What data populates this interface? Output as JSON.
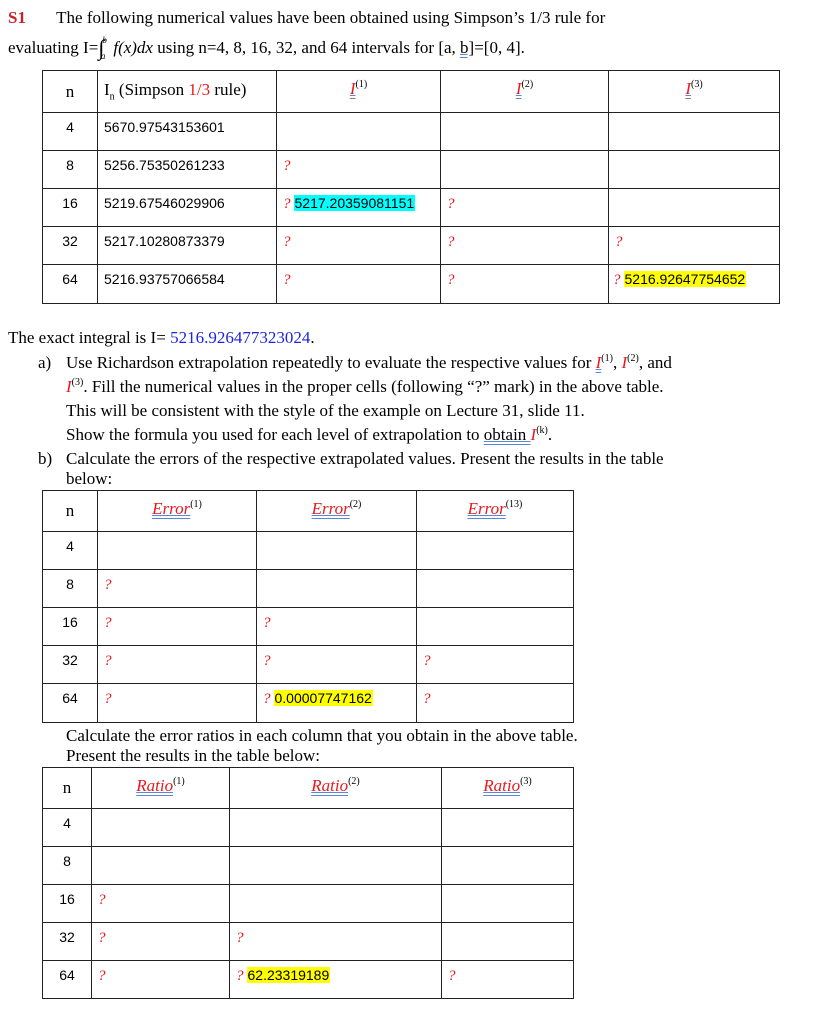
{
  "problem": {
    "label": "S1",
    "intro_line1": "The following numerical values have been obtained using Simpson’s 1/3 rule for",
    "intro_line2_prefix": "evaluating I=",
    "integral_upper": "b",
    "integral_lower": "a",
    "integrand": "f(x)dx",
    "intro_line2_suffix_a": " using n=4, 8, 16, 32, and 64 intervals for [a, ",
    "intro_line2_b": "b]",
    "intro_line2_suffix_b": "=[0, 4]."
  },
  "table1": {
    "headers": {
      "n": "n",
      "in_prefix": "I",
      "in_sub": "n",
      "in_mid": " (Simpson ",
      "in_rule": "1/3",
      "in_suffix": " rule)",
      "i_symbol": "I",
      "i1_sup": "(1)",
      "i2_sup": "(2)",
      "i3_sup": "(3)"
    },
    "rows": [
      {
        "n": "4",
        "value": "5670.97543153601",
        "i1": "",
        "i1_val": "",
        "i2": "",
        "i2_val": "",
        "i3": "",
        "i3_val": ""
      },
      {
        "n": "8",
        "value": "5256.75350261233",
        "i1": "?",
        "i1_val": "",
        "i2": "",
        "i2_val": "",
        "i3": "",
        "i3_val": ""
      },
      {
        "n": "16",
        "value": "5219.67546029906",
        "i1": "?",
        "i1_val": "5217.20359081151",
        "i2": "?",
        "i2_val": "",
        "i3": "",
        "i3_val": ""
      },
      {
        "n": "32",
        "value": "5217.10280873379",
        "i1": "?",
        "i1_val": "",
        "i2": "?",
        "i2_val": "",
        "i3": "?",
        "i3_val": ""
      },
      {
        "n": "64",
        "value": "5216.93757066584",
        "i1": "?",
        "i1_val": "",
        "i2": "?",
        "i2_val": "",
        "i3": "?",
        "i3_val": "5216.92647754652"
      }
    ]
  },
  "exact": {
    "prefix": "The exact integral is I=",
    "value": "5216.926477323024",
    "suffix": "."
  },
  "part_a": {
    "label": "a)",
    "line1_prefix": "Use Richardson extrapolation repeatedly to evaluate the respective values for ",
    "sup1": "(1)",
    "sep1": ", ",
    "sup2": "(2)",
    "sep2": ", and",
    "sup3": "(3)",
    "line2": ".  Fill the numerical values in the proper cells (following “?” mark) in the above table.",
    "line3": "This will be consistent with the style of the example on Lecture 31, slide 11.",
    "line4_prefix": "Show the formula you used for each level of extrapolation to ",
    "line4_obtain": "obtain ",
    "supk": "(k)",
    "line4_suffix": "."
  },
  "part_b": {
    "label": "b)",
    "line1": "Calculate the errors of the respective extrapolated values. Present the results in the table",
    "line2": "below:"
  },
  "table2": {
    "headers": {
      "n": "n",
      "e": "Error",
      "e1_sup": "(1)",
      "e2_sup": "(2)",
      "e3_sup": "(13)"
    },
    "rows": [
      {
        "n": "4",
        "e1": "",
        "e2": "",
        "e2_val": "",
        "e3": ""
      },
      {
        "n": "8",
        "e1": "?",
        "e2": "",
        "e2_val": "",
        "e3": ""
      },
      {
        "n": "16",
        "e1": "?",
        "e2": "?",
        "e2_val": "",
        "e3": ""
      },
      {
        "n": "32",
        "e1": "?",
        "e2": "?",
        "e2_val": "",
        "e3": "?"
      },
      {
        "n": "64",
        "e1": "?",
        "e2": "?",
        "e2_val": "0.00007747162",
        "e3": "?"
      }
    ]
  },
  "ratios_text": {
    "line1": "Calculate the error ratios in each column that you obtain in the above table.",
    "line2": "Present the results in the table below:"
  },
  "table3": {
    "headers": {
      "n": "n",
      "r": "Ratio",
      "r1_sup": "(1)",
      "r2_sup": "(2)",
      "r3_sup": "(3)"
    },
    "rows": [
      {
        "n": "4",
        "r1": "",
        "r2": "",
        "r2_val": "",
        "r3": ""
      },
      {
        "n": "8",
        "r1": "",
        "r2": "",
        "r2_val": "",
        "r3": ""
      },
      {
        "n": "16",
        "r1": "?",
        "r2": "",
        "r2_val": "",
        "r3": ""
      },
      {
        "n": "32",
        "r1": "?",
        "r2": "?",
        "r2_val": "",
        "r3": ""
      },
      {
        "n": "64",
        "r1": "?",
        "r2": "?",
        "r2_val": "62.23319189",
        "r3": "?"
      }
    ]
  }
}
